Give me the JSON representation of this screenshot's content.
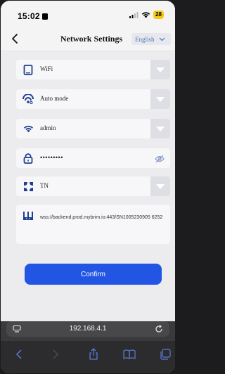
{
  "status_bar": {
    "time": "15:02",
    "battery": "28"
  },
  "nav": {
    "title": "Network Settings",
    "language": "English"
  },
  "fields": {
    "connection_type": "WiFi",
    "mode": "Auto mode",
    "ssid": "admin",
    "password_masked": "•••••••••",
    "region": "TN",
    "server_url": "wss://backend.prod.mybrim.io:443/SN1005230905 6252"
  },
  "confirm_label": "Confirm",
  "browser": {
    "address": "192.168.4.1"
  },
  "colors": {
    "accent": "#2255e4",
    "icon_navy": "#1f3f8f",
    "language_text": "#4e72b8"
  },
  "icons": {
    "connection_type": "tablet-icon",
    "mode": "auto-mode-icon",
    "ssid": "wifi-icon",
    "password": "lock-icon",
    "password_toggle": "eye-slash-icon",
    "region": "region-icon",
    "server": "server-icon"
  }
}
